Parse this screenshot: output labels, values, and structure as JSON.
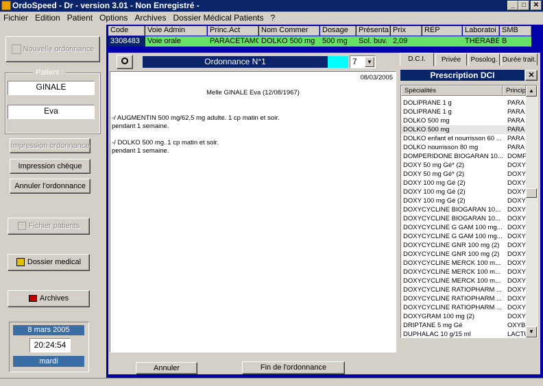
{
  "window": {
    "title": "OrdoSpeed - Dr    - version 3.01 - Non Enregistré -"
  },
  "menu": [
    "Fichier",
    "Edition",
    "Patient",
    "Options",
    "Archives",
    "Dossier Médical Patients",
    "?"
  ],
  "left": {
    "new_order": "Nouvelle ordonnance",
    "patient_label": "Patient :",
    "patient_lastname": "GINALE",
    "patient_firstname": "Eva",
    "print_order": "Impression ordonnance",
    "print_check": "Impression chèque",
    "cancel_order": "Annuler l'ordonnance",
    "patient_files": "Fichier patients",
    "medical_file": "Dossier medical",
    "archives": "Archives",
    "date": "8 mars 2005",
    "time": "20:24:54",
    "weekday": "mardi"
  },
  "grid": {
    "headers": [
      "Code",
      "Voie Admin",
      "Princ.Act",
      "Nom Commer",
      "Dosage",
      "Présenta",
      "Prix",
      "REP",
      "Laboratoi",
      "SMB"
    ],
    "row": [
      "3308483",
      "Voie orale",
      "PARACETAMO",
      "DOLKO  500 mg",
      "500 mg",
      "Sol. buv.",
      "2,09",
      "",
      "THERABE",
      "B"
    ]
  },
  "ordonnance": {
    "title": "Ordonnance N°1",
    "page_num": "7",
    "date": "08/03/2005",
    "patient_line": "Melle GINALE Eva (12/08/1967)",
    "lines": [
      "-/ AUGMENTIN  500 mg/62,5 mg adulte. 1 cp matin et soir.",
      "pendant 1 semaine.",
      "",
      "-/ DOLKO  500 mg. 1 cp matin et soir.",
      "pendant 1 semaine."
    ],
    "cancel": "Annuler",
    "finish": "Fin de l'ordonnance"
  },
  "right": {
    "tabs": [
      "D.C.I.",
      "Privée",
      "Posolog.",
      "Durée trait."
    ],
    "panel_title": "Prescription DCI",
    "col_specialites": "Spécialités",
    "col_principe": "Princip",
    "items": [
      [
        "DOLIPRANE 1 g",
        "PARA"
      ],
      [
        "DOLIPRANE 1 g",
        "PARA"
      ],
      [
        "DOLKO  500 mg",
        "PARA"
      ],
      [
        "DOLKO  500 mg",
        "PARA"
      ],
      [
        "DOLKO enfant et nourrisson 60 ...",
        "PARA"
      ],
      [
        "DOLKO nourrisson 80 mg",
        "PARA"
      ],
      [
        "DOMPERIDONE BIOGARAN 10...",
        "DOMP"
      ],
      [
        "DOXY  50 mg Gé* (2)",
        "DOXY"
      ],
      [
        "DOXY  50 mg Gé* (2)",
        "DOXY"
      ],
      [
        "DOXY 100 mg Gé (2)",
        "DOXY"
      ],
      [
        "DOXY 100 mg Gé (2)",
        "DOXY"
      ],
      [
        "DOXY 100 mg Gé (2)",
        "DOXY"
      ],
      [
        "DOXYCYCLINE BIOGARAN 10...",
        "DOXY"
      ],
      [
        "DOXYCYCLINE BIOGARAN 10...",
        "DOXY"
      ],
      [
        "DOXYCYCLINE G GAM 100 mg...",
        "DOXY"
      ],
      [
        "DOXYCYCLINE G GAM 100 mg...",
        "DOXY"
      ],
      [
        "DOXYCYCLINE GNR 100 mg (2)",
        "DOXY"
      ],
      [
        "DOXYCYCLINE GNR 100 mg (2)",
        "DOXY"
      ],
      [
        "DOXYCYCLINE MERCK 100 m...",
        "DOXY"
      ],
      [
        "DOXYCYCLINE MERCK 100 m...",
        "DOXY"
      ],
      [
        "DOXYCYCLINE MERCK 100 m...",
        "DOXY"
      ],
      [
        "DOXYCYCLINE RATIOPHARM ...",
        "DOXY"
      ],
      [
        "DOXYCYCLINE RATIOPHARM ...",
        "DOXY"
      ],
      [
        "DOXYCYCLINE RATIOPHARM ...",
        "DOXY"
      ],
      [
        "DOXYGRAM 100 mg (2)",
        "DOXY"
      ],
      [
        "DRIPTANE 5 mg Gé",
        "OXYB"
      ],
      [
        "DUPHALAC 10 g/15 ml",
        "LACTU"
      ]
    ],
    "selected_index": 3
  },
  "colors": {
    "title_bg": "#0a246a",
    "frame_blue": "#0000aa",
    "row_green": "#66e066",
    "accent_cyan": "#00ffff"
  }
}
